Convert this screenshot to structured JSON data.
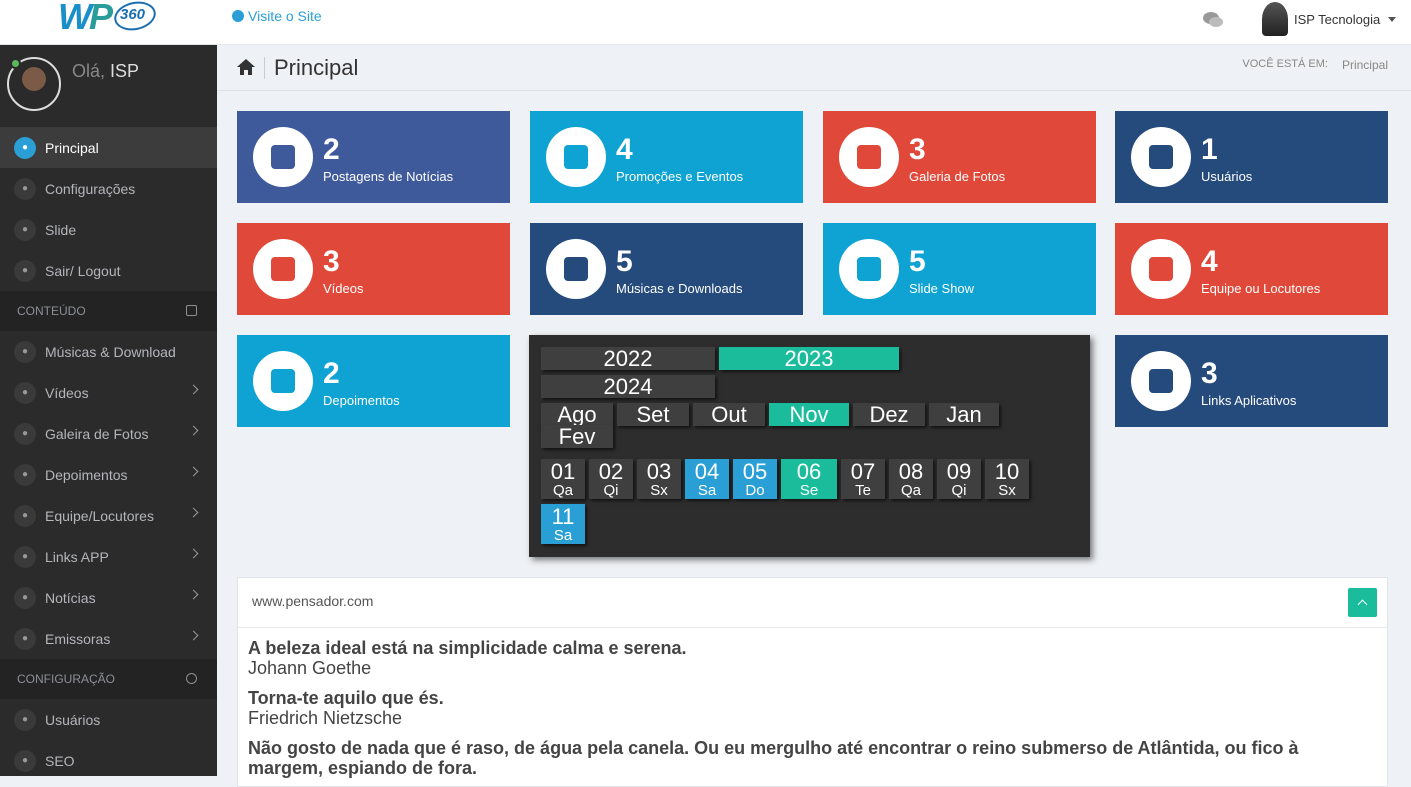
{
  "header": {
    "visit_label": "Visite o Site",
    "user_name": "ISP Tecnologia",
    "logo_text": "WP 360"
  },
  "sidebar": {
    "greeting_prefix": "Olá,",
    "greeting_name": "ISP",
    "items_main": [
      {
        "label": "Principal",
        "icon": "home-icon"
      },
      {
        "label": "Configurações",
        "icon": "gear-icon"
      },
      {
        "label": "Slide",
        "icon": "image-icon"
      },
      {
        "label": "Sair/ Logout",
        "icon": "power-icon"
      }
    ],
    "section_content": "CONTEÚDO",
    "items_content": [
      {
        "label": "Músicas & Download",
        "icon": "cloud-download-icon"
      },
      {
        "label": "Vídeos",
        "icon": "video-icon"
      },
      {
        "label": "Galeira de Fotos",
        "icon": "image-icon"
      },
      {
        "label": "Depoimentos",
        "icon": "megaphone-icon"
      },
      {
        "label": "Equipe/Locutores",
        "icon": "users-icon"
      },
      {
        "label": "Links APP",
        "icon": "briefcase-icon"
      },
      {
        "label": "Notícias",
        "icon": "pencil-icon"
      },
      {
        "label": "Emissoras",
        "icon": "wrench-icon"
      }
    ],
    "section_config": "CONFIGURAÇÃO",
    "items_config": [
      {
        "label": "Usuários",
        "icon": "user-icon"
      },
      {
        "label": "SEO",
        "icon": "globe-icon"
      }
    ]
  },
  "page": {
    "title": "Principal",
    "breadcrumb_label": "VOCÊ ESTÁ EM:",
    "breadcrumb_current": "Principal"
  },
  "stats": [
    {
      "value": "2",
      "label": "Postagens de Notícias",
      "color": "#3f5a9a",
      "icon": "pencil-icon"
    },
    {
      "value": "4",
      "label": "Promoções e Eventos",
      "color": "#0ea3d3",
      "icon": "calendar-icon"
    },
    {
      "value": "3",
      "label": "Galeria de Fotos",
      "color": "#e0493a",
      "icon": "picture-icon"
    },
    {
      "value": "1",
      "label": "Usuários",
      "color": "#254a7c",
      "icon": "user-icon"
    },
    {
      "value": "3",
      "label": "Vídeos",
      "color": "#e0493a",
      "icon": "video-camera-icon"
    },
    {
      "value": "5",
      "label": "Músicas e Downloads",
      "color": "#254a7c",
      "icon": "audio-file-icon"
    },
    {
      "value": "5",
      "label": "Slide Show",
      "color": "#0ea3d3",
      "icon": "sliders-icon"
    },
    {
      "value": "4",
      "label": "Equipe ou Locutores",
      "color": "#e0493a",
      "icon": "users-icon"
    },
    {
      "value": "2",
      "label": "Depoimentos",
      "color": "#0ea3d3",
      "icon": "megaphone-icon"
    },
    {
      "value": "3",
      "label": "Links Aplicativos",
      "color": "#254a7c",
      "icon": "mobile-icon"
    }
  ],
  "calendar": {
    "years": [
      "2022",
      "2023",
      "2024"
    ],
    "selected_year": "2023",
    "months": [
      "Ago",
      "Set",
      "Out",
      "Nov",
      "Dez",
      "Jan",
      "Fev"
    ],
    "selected_month": "Nov",
    "days": [
      {
        "n": "01",
        "w": "Qa"
      },
      {
        "n": "02",
        "w": "Qi"
      },
      {
        "n": "03",
        "w": "Sx"
      },
      {
        "n": "04",
        "w": "Sa"
      },
      {
        "n": "05",
        "w": "Do"
      },
      {
        "n": "06",
        "w": "Se"
      },
      {
        "n": "07",
        "w": "Te"
      },
      {
        "n": "08",
        "w": "Qa"
      },
      {
        "n": "09",
        "w": "Qi"
      },
      {
        "n": "10",
        "w": "Sx"
      },
      {
        "n": "11",
        "w": "Sa"
      }
    ],
    "selected_day": "06",
    "weekend_days": [
      "04",
      "05",
      "11"
    ]
  },
  "quotes": {
    "source": "www.pensador.com",
    "items": [
      {
        "text": "A beleza ideal está na simplicidade calma e serena.",
        "author": "Johann Goethe"
      },
      {
        "text": "Torna-te aquilo que és.",
        "author": "Friedrich Nietzsche"
      },
      {
        "text": "Não gosto de nada que é raso, de água pela canela. Ou eu mergulho até encontrar o reino submerso de Atlântida, ou fico à margem, espiando de fora.",
        "author": ""
      }
    ]
  }
}
